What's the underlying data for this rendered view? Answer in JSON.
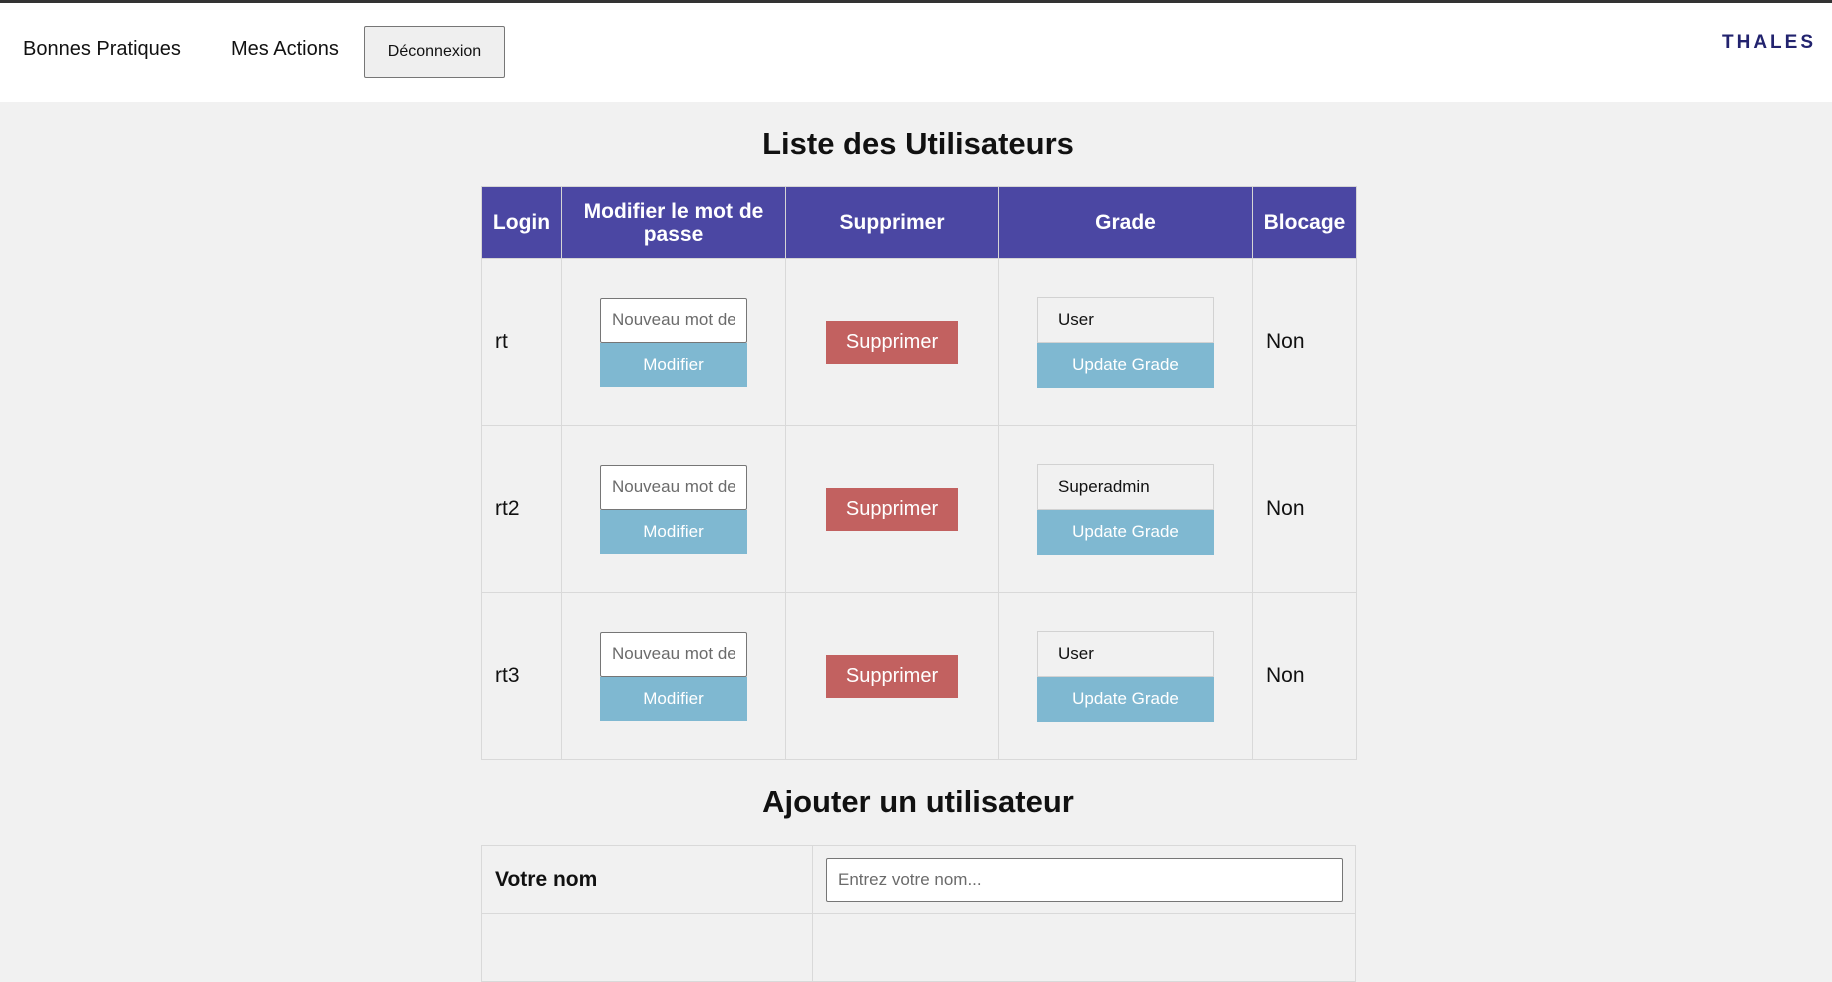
{
  "nav": {
    "links": [
      {
        "label": "Bonnes Pratiques"
      },
      {
        "label": "Mes Actions"
      }
    ],
    "logout_label": "Déconnexion",
    "logo_text": "THALES"
  },
  "users_section": {
    "title": "Liste des Utilisateurs",
    "columns": [
      "Login",
      "Modifier le mot de passe",
      "Supprimer",
      "Grade",
      "Blocage"
    ],
    "password_placeholder": "Nouveau mot de passe",
    "modify_label": "Modifier",
    "delete_label": "Supprimer",
    "update_grade_label": "Update Grade",
    "rows": [
      {
        "login": "rt",
        "grade": "User",
        "blocage": "Non"
      },
      {
        "login": "rt2",
        "grade": "Superadmin",
        "blocage": "Non"
      },
      {
        "login": "rt3",
        "grade": "User",
        "blocage": "Non"
      }
    ]
  },
  "add_section": {
    "title": "Ajouter un utilisateur",
    "name_label": "Votre nom",
    "name_placeholder": "Entrez votre nom..."
  },
  "colors": {
    "header_bg": "#4b47a3",
    "delete_button": "#c26160",
    "action_button": "#7fb8d1",
    "logo": "#22236e"
  }
}
